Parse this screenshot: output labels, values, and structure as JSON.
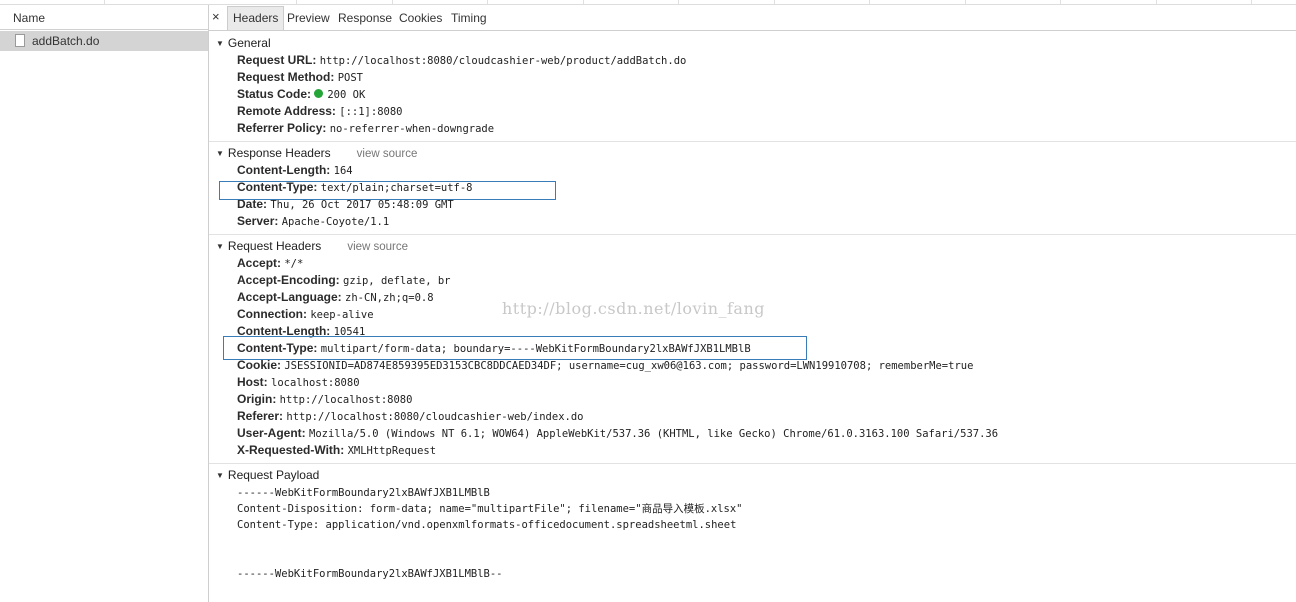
{
  "left_panel": {
    "name_header": "Name",
    "request_name": "addBatch.do"
  },
  "tabs": [
    {
      "label": "Headers",
      "active": true
    },
    {
      "label": "Preview",
      "active": false
    },
    {
      "label": "Response",
      "active": false
    },
    {
      "label": "Cookies",
      "active": false
    },
    {
      "label": "Timing",
      "active": false
    }
  ],
  "close_glyph": "×",
  "general": {
    "title": "General",
    "rows": [
      {
        "key": "Request URL:",
        "value": "http://localhost:8080/cloudcashier-web/product/addBatch.do"
      },
      {
        "key": "Request Method:",
        "value": "POST"
      },
      {
        "key": "Status Code:",
        "value": "200 OK",
        "status_color": "#25a538"
      },
      {
        "key": "Remote Address:",
        "value": "[::1]:8080"
      },
      {
        "key": "Referrer Policy:",
        "value": "no-referrer-when-downgrade"
      }
    ]
  },
  "response_headers": {
    "title": "Response Headers",
    "view_source": "view source",
    "rows": [
      {
        "key": "Content-Length:",
        "value": "164"
      },
      {
        "key": "Content-Type:",
        "value": "text/plain;charset=utf-8"
      },
      {
        "key": "Date:",
        "value": "Thu, 26 Oct 2017 05:48:09 GMT"
      },
      {
        "key": "Server:",
        "value": "Apache-Coyote/1.1"
      }
    ]
  },
  "request_headers": {
    "title": "Request Headers",
    "view_source": "view source",
    "rows": [
      {
        "key": "Accept:",
        "value": "*/*"
      },
      {
        "key": "Accept-Encoding:",
        "value": "gzip, deflate, br"
      },
      {
        "key": "Accept-Language:",
        "value": "zh-CN,zh;q=0.8"
      },
      {
        "key": "Connection:",
        "value": "keep-alive"
      },
      {
        "key": "Content-Length:",
        "value": "10541"
      },
      {
        "key": "Content-Type:",
        "value": "multipart/form-data; boundary=----WebKitFormBoundary2lxBAWfJXB1LMBlB"
      },
      {
        "key": "Cookie:",
        "value": "JSESSIONID=AD874E859395ED3153CBC8DDCAED34DF; username=cug_xw06@163.com; password=LWN19910708; rememberMe=true"
      },
      {
        "key": "Host:",
        "value": "localhost:8080"
      },
      {
        "key": "Origin:",
        "value": "http://localhost:8080"
      },
      {
        "key": "Referer:",
        "value": "http://localhost:8080/cloudcashier-web/index.do"
      },
      {
        "key": "User-Agent:",
        "value": "Mozilla/5.0 (Windows NT 6.1; WOW64) AppleWebKit/537.36 (KHTML, like Gecko) Chrome/61.0.3163.100 Safari/537.36"
      },
      {
        "key": "X-Requested-With:",
        "value": "XMLHttpRequest"
      }
    ]
  },
  "request_payload": {
    "title": "Request Payload",
    "lines": [
      "------WebKitFormBoundary2lxBAWfJXB1LMBlB",
      "Content-Disposition: form-data; name=\"multipartFile\"; filename=\"商品导入模板.xlsx\"",
      "Content-Type: application/vnd.openxmlformats-officedocument.spreadsheetml.sheet",
      "",
      "",
      "------WebKitFormBoundary2lxBAWfJXB1LMBlB--"
    ]
  },
  "watermark": "http://blog.csdn.net/lovin_fang",
  "colors": {
    "highlight_box": "#3a7cb8",
    "selected_row": "#d4d4d4"
  }
}
